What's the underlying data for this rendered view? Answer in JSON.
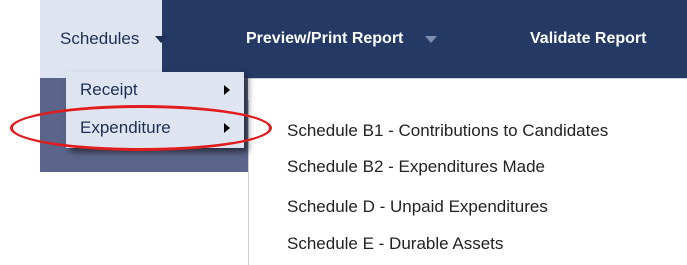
{
  "navbar": {
    "tabs": [
      {
        "label": "Schedules",
        "caret": true
      },
      {
        "label": "Preview/Print Report",
        "caret": true
      },
      {
        "label": "Validate Report",
        "caret": false
      }
    ]
  },
  "dropdown": {
    "items": [
      {
        "label": "Receipt"
      },
      {
        "label": "Expenditure"
      }
    ]
  },
  "submenu": {
    "items": [
      {
        "label": "Schedule B1 - Contributions to Candidates"
      },
      {
        "label": "Schedule B2 - Expenditures Made"
      },
      {
        "label": "Schedule D - Unpaid Expenditures"
      },
      {
        "label": "Schedule E - Durable Assets"
      }
    ]
  },
  "colors": {
    "navbar_bg": "#243a64",
    "active_tab_bg": "#dfe5f0",
    "highlight_ring": "#e21c1c"
  }
}
